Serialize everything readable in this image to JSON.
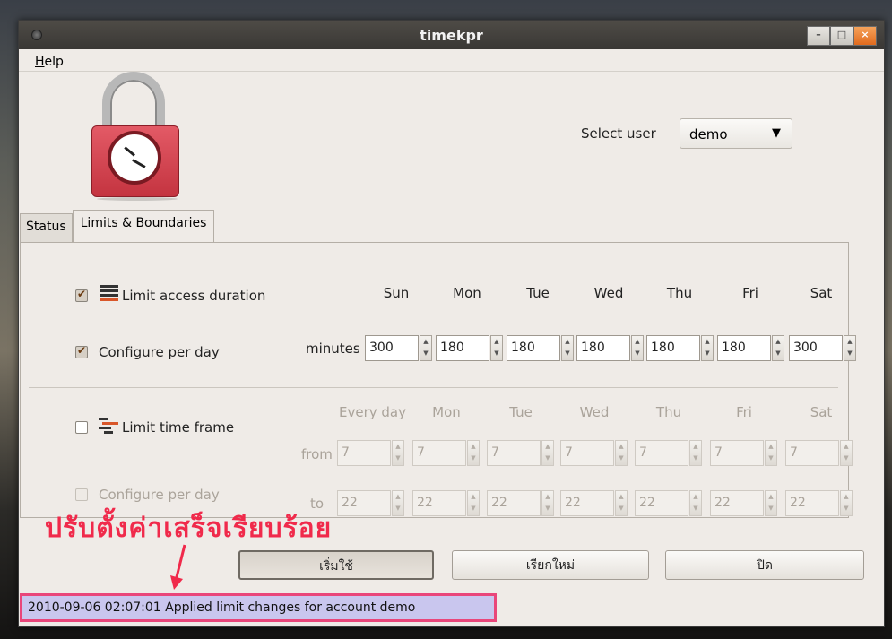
{
  "window": {
    "title": "timekpr"
  },
  "menu": {
    "help": "Help",
    "help_accel": "H",
    "help_rest": "elp"
  },
  "user": {
    "label": "Select user",
    "value": "demo"
  },
  "tabs": [
    {
      "label": "Status"
    },
    {
      "label": "Limits & Boundaries"
    }
  ],
  "limits": {
    "limit_access_label": "Limit access duration",
    "configure_per_day_label": "Configure per day",
    "minutes_label": "minutes",
    "days": [
      "Sun",
      "Mon",
      "Tue",
      "Wed",
      "Thu",
      "Fri",
      "Sat"
    ],
    "minutes": [
      "300",
      "180",
      "180",
      "180",
      "180",
      "180",
      "300"
    ]
  },
  "timeframe": {
    "limit_label": "Limit time frame",
    "configure_per_day_label": "Configure per day",
    "headers": [
      "Every day",
      "Mon",
      "Tue",
      "Wed",
      "Thu",
      "Fri",
      "Sat"
    ],
    "from_label": "from",
    "to_label": "to",
    "from": [
      "7",
      "7",
      "7",
      "7",
      "7",
      "7",
      "7"
    ],
    "to": [
      "22",
      "22",
      "22",
      "22",
      "22",
      "22",
      "22"
    ]
  },
  "buttons": {
    "apply": "เริ่มใช้",
    "reset": "เรียกใหม่",
    "close": "ปิด"
  },
  "annotation": "ปรับตั้งค่าเสร็จเรียบร้อย",
  "status": "2010-09-06 02:07:01 Applied limit changes for account demo"
}
